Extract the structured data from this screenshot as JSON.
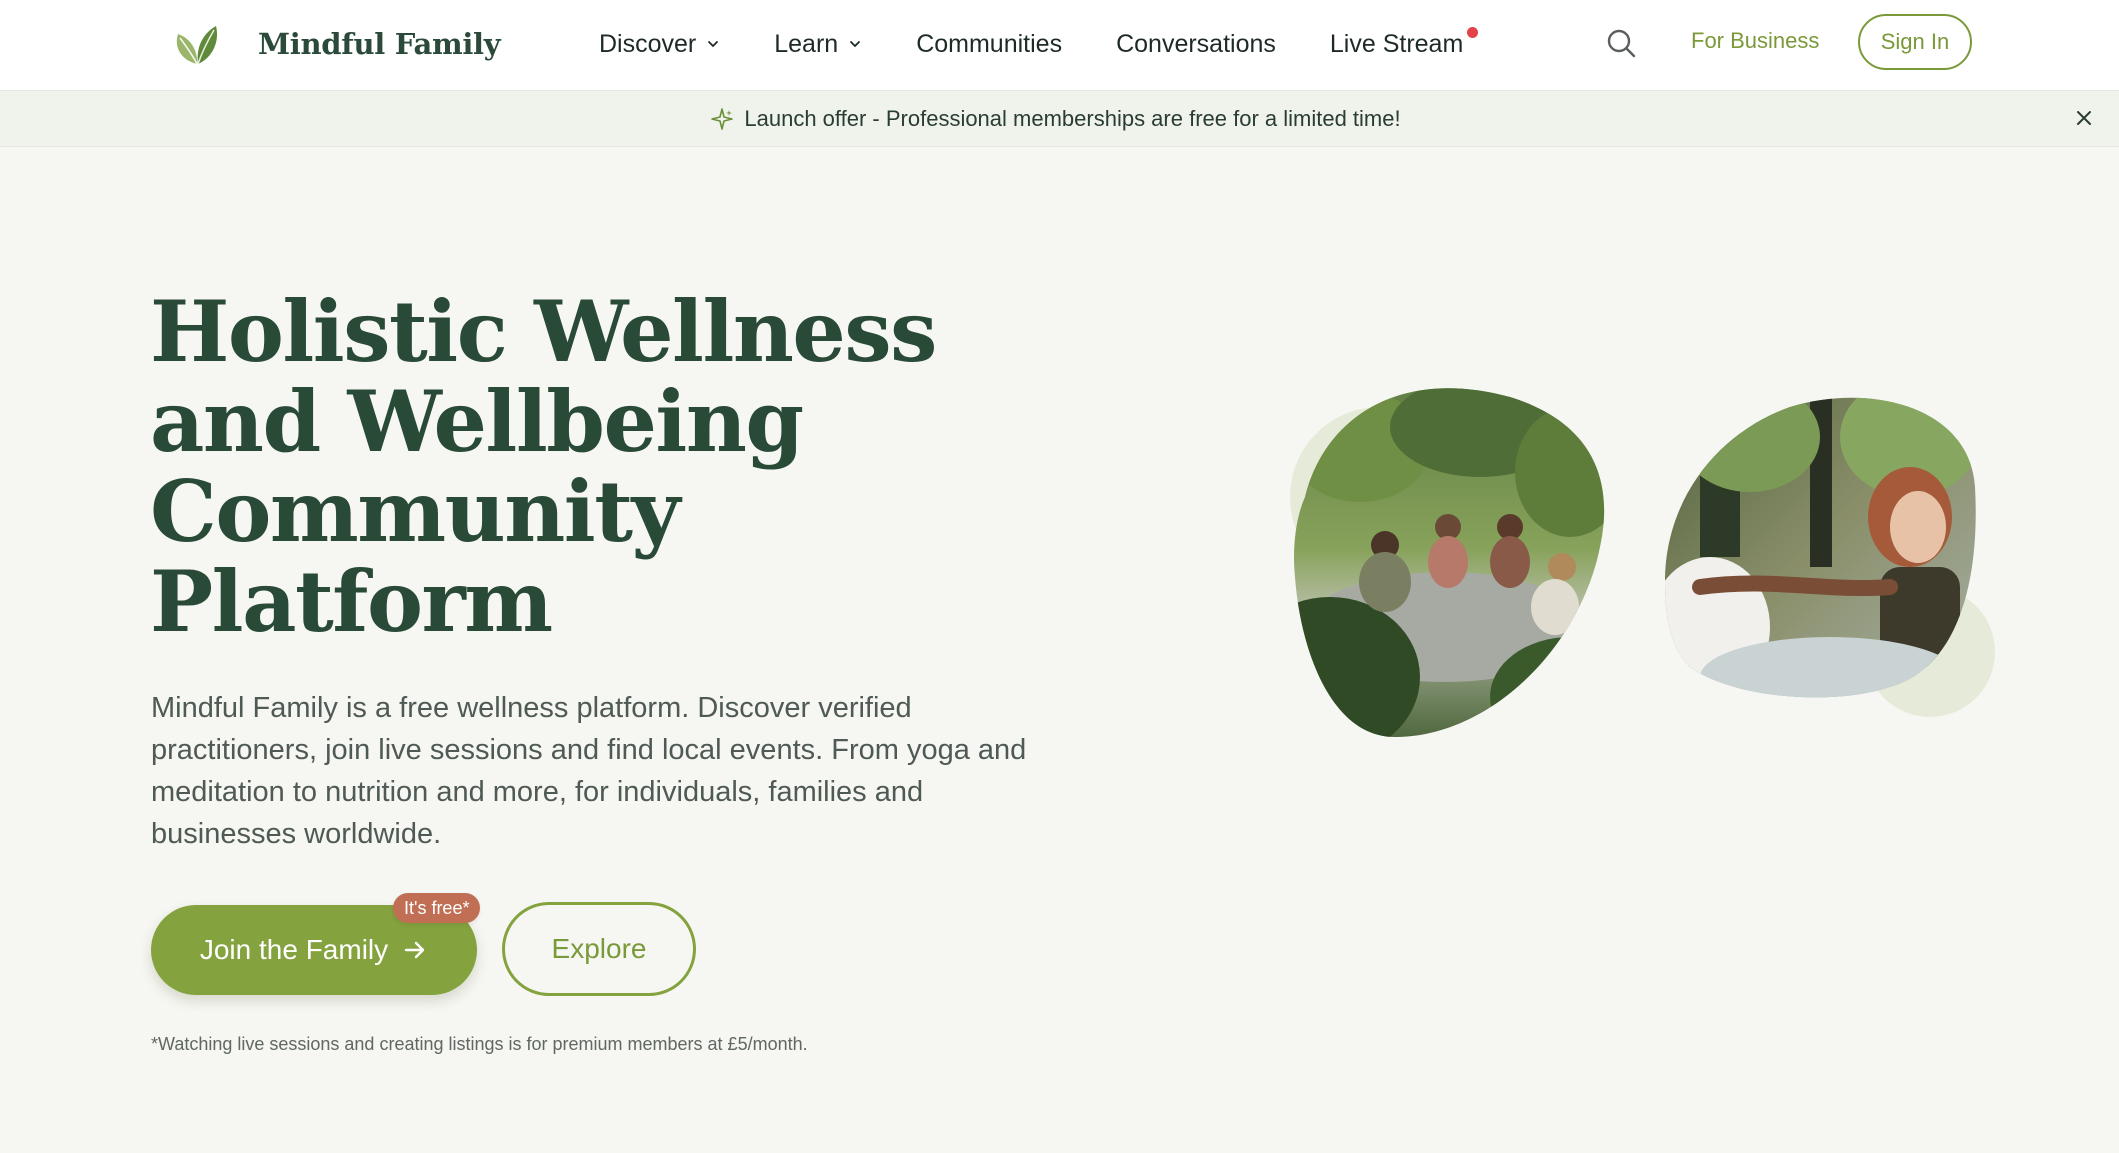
{
  "brand": {
    "name": "Mindful Family"
  },
  "nav": {
    "items": [
      {
        "label": "Discover",
        "has_dropdown": true
      },
      {
        "label": "Learn",
        "has_dropdown": true
      },
      {
        "label": "Communities",
        "has_dropdown": false
      },
      {
        "label": "Conversations",
        "has_dropdown": false
      },
      {
        "label": "Live Stream",
        "has_dropdown": false,
        "live_indicator": true
      }
    ],
    "search_icon": "search-icon",
    "for_business_label": "For Business",
    "sign_in_label": "Sign In"
  },
  "banner": {
    "icon": "sparkle-icon",
    "text": "Launch offer - Professional memberships are free for a limited time!",
    "close_icon": "close-icon"
  },
  "hero": {
    "title": "Holistic Wellness and Wellbeing Community Platform",
    "description": "Mindful Family is a free wellness platform. Discover verified practitioners, join live sessions and find local events. From yoga and meditation to nutrition and more, for individuals, families and businesses worldwide.",
    "primary_cta": "Join the Family",
    "primary_cta_badge": "It's free*",
    "secondary_cta": "Explore",
    "footnote": "*Watching live sessions and creating listings is for premium members at £5/month."
  },
  "colors": {
    "brand_green": "#84a23e",
    "heading_green": "#2a4a38",
    "badge_terracotta": "#c06f55",
    "live_red": "#e2434b",
    "banner_bg": "#f0f3ec",
    "hero_bg": "#f6f6f2"
  }
}
